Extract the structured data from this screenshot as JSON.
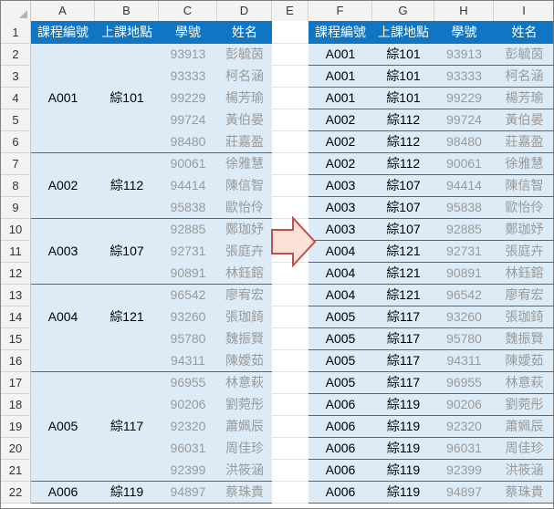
{
  "columns": [
    "A",
    "B",
    "C",
    "D",
    "E",
    "F",
    "G",
    "H",
    "I"
  ],
  "row_numbers": [
    "1",
    "2",
    "3",
    "4",
    "5",
    "6",
    "7",
    "8",
    "9",
    "10",
    "11",
    "12",
    "13",
    "14",
    "15",
    "16",
    "17",
    "18",
    "19",
    "20",
    "21",
    "22"
  ],
  "headers": [
    "課程編號",
    "上課地點",
    "學號",
    "姓名"
  ],
  "left_groups": [
    {
      "course": "A001",
      "location": "綜101",
      "rows": [
        [
          "93913",
          "彭毓茵"
        ],
        [
          "93333",
          "柯名涵"
        ],
        [
          "99229",
          "楊芳瑜"
        ],
        [
          "99724",
          "黃伯晏"
        ],
        [
          "98480",
          "莊嘉盈"
        ]
      ]
    },
    {
      "course": "A002",
      "location": "綜112",
      "rows": [
        [
          "90061",
          "徐雅慧"
        ],
        [
          "94414",
          "陳信智"
        ],
        [
          "95838",
          "歐怡伶"
        ]
      ]
    },
    {
      "course": "A003",
      "location": "綜107",
      "rows": [
        [
          "92885",
          "鄭珈妤"
        ],
        [
          "92731",
          "張庭卉"
        ],
        [
          "90891",
          "林鈺鎔"
        ]
      ]
    },
    {
      "course": "A004",
      "location": "綜121",
      "rows": [
        [
          "96542",
          "廖宥宏"
        ],
        [
          "93260",
          "張珈錡"
        ],
        [
          "95780",
          "魏振賢"
        ],
        [
          "94311",
          "陳嬡茹"
        ]
      ]
    },
    {
      "course": "A005",
      "location": "綜117",
      "rows": [
        [
          "96955",
          "林意萩"
        ],
        [
          "90206",
          "劉菀彤"
        ],
        [
          "92320",
          "蕭姵辰"
        ],
        [
          "96031",
          "周佳珍"
        ],
        [
          "92399",
          "洪筱涵"
        ]
      ]
    },
    {
      "course": "A006",
      "location": "綜119",
      "rows": [
        [
          "94897",
          "蔡珠貴"
        ]
      ]
    }
  ],
  "right_rows": [
    [
      "A001",
      "綜101",
      "93913",
      "彭毓茵"
    ],
    [
      "A001",
      "綜101",
      "93333",
      "柯名涵"
    ],
    [
      "A001",
      "綜101",
      "99229",
      "楊芳瑜"
    ],
    [
      "A002",
      "綜112",
      "99724",
      "黃伯晏"
    ],
    [
      "A002",
      "綜112",
      "98480",
      "莊嘉盈"
    ],
    [
      "A002",
      "綜112",
      "90061",
      "徐雅慧"
    ],
    [
      "A003",
      "綜107",
      "94414",
      "陳信智"
    ],
    [
      "A003",
      "綜107",
      "95838",
      "歐怡伶"
    ],
    [
      "A003",
      "綜107",
      "92885",
      "鄭珈妤"
    ],
    [
      "A004",
      "綜121",
      "92731",
      "張庭卉"
    ],
    [
      "A004",
      "綜121",
      "90891",
      "林鈺鎔"
    ],
    [
      "A004",
      "綜121",
      "96542",
      "廖宥宏"
    ],
    [
      "A005",
      "綜117",
      "93260",
      "張珈錡"
    ],
    [
      "A005",
      "綜117",
      "95780",
      "魏振賢"
    ],
    [
      "A005",
      "綜117",
      "94311",
      "陳嬡茹"
    ],
    [
      "A005",
      "綜117",
      "96955",
      "林意萩"
    ],
    [
      "A006",
      "綜119",
      "90206",
      "劉菀彤"
    ],
    [
      "A006",
      "綜119",
      "92320",
      "蕭姵辰"
    ],
    [
      "A006",
      "綜119",
      "96031",
      "周佳珍"
    ],
    [
      "A006",
      "綜119",
      "92399",
      "洪筱涵"
    ],
    [
      "A006",
      "綜119",
      "94897",
      "蔡珠貴"
    ]
  ],
  "colors": {
    "header_bg": "#1075c2",
    "band_bg": "#dcebf6",
    "border": "#2d73b4",
    "arrow_fill": "#fbe1d6",
    "arrow_stroke": "#c0504d",
    "gray_text": "#9a9a9a"
  },
  "arrow_icon": "right-arrow-icon"
}
